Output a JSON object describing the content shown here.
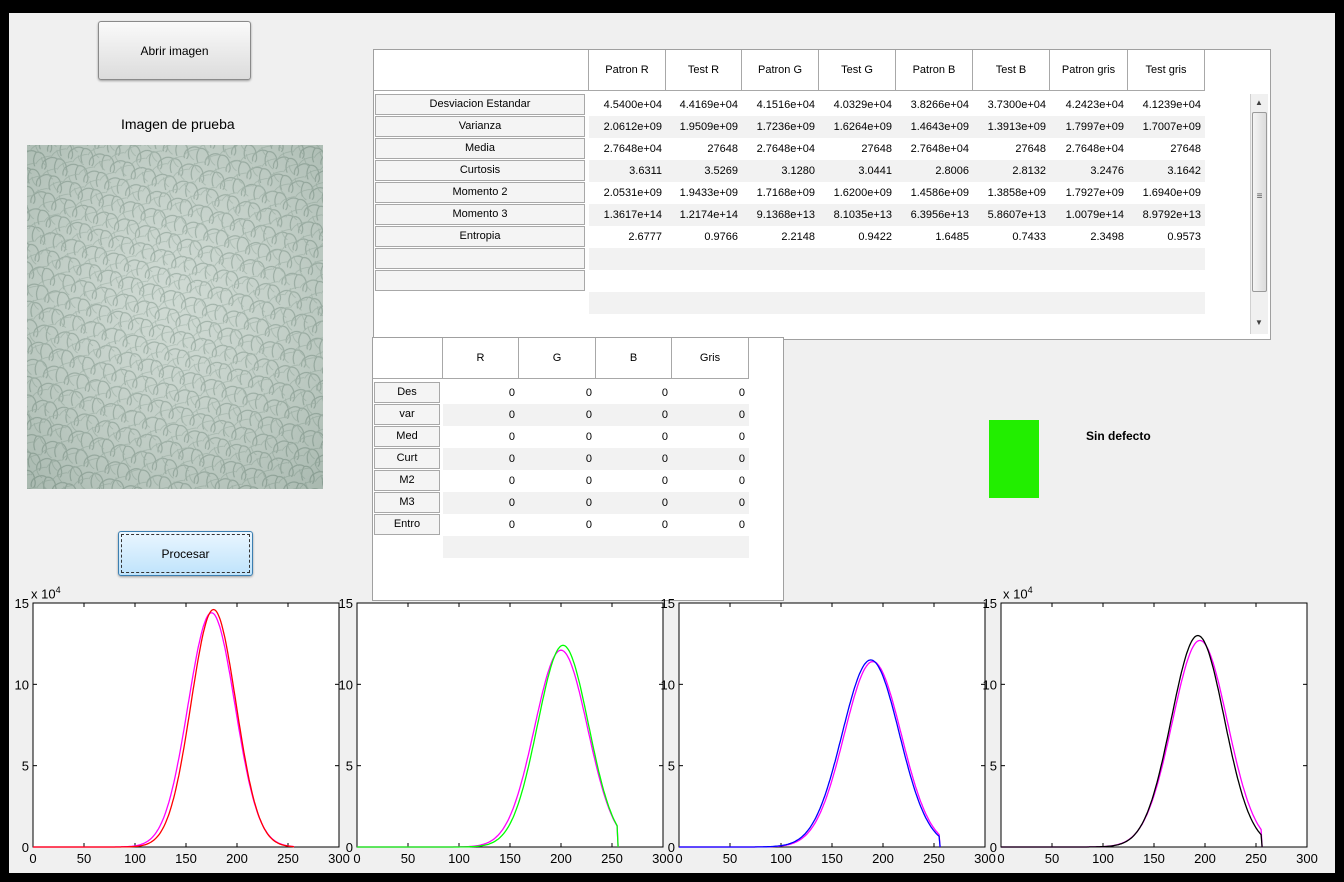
{
  "buttons": {
    "open": "Abrir imagen",
    "process": "Procesar"
  },
  "image_label": "Imagen de prueba",
  "stats_table": {
    "columns": [
      "Patron R",
      "Test R",
      "Patron G",
      "Test G",
      "Patron B",
      "Test B",
      "Patron gris",
      "Test gris"
    ],
    "rows": [
      {
        "label": "Desviacion Estandar",
        "values": [
          "4.5400e+04",
          "4.4169e+04",
          "4.1516e+04",
          "4.0329e+04",
          "3.8266e+04",
          "3.7300e+04",
          "4.2423e+04",
          "4.1239e+04"
        ]
      },
      {
        "label": "Varianza",
        "values": [
          "2.0612e+09",
          "1.9509e+09",
          "1.7236e+09",
          "1.6264e+09",
          "1.4643e+09",
          "1.3913e+09",
          "1.7997e+09",
          "1.7007e+09"
        ]
      },
      {
        "label": "Media",
        "values": [
          "2.7648e+04",
          "27648",
          "2.7648e+04",
          "27648",
          "2.7648e+04",
          "27648",
          "2.7648e+04",
          "27648"
        ]
      },
      {
        "label": "Curtosis",
        "values": [
          "3.6311",
          "3.5269",
          "3.1280",
          "3.0441",
          "2.8006",
          "2.8132",
          "3.2476",
          "3.1642"
        ]
      },
      {
        "label": "Momento 2",
        "values": [
          "2.0531e+09",
          "1.9433e+09",
          "1.7168e+09",
          "1.6200e+09",
          "1.4586e+09",
          "1.3858e+09",
          "1.7927e+09",
          "1.6940e+09"
        ]
      },
      {
        "label": "Momento 3",
        "values": [
          "1.3617e+14",
          "1.2174e+14",
          "9.1368e+13",
          "8.1035e+13",
          "6.3956e+13",
          "5.8607e+13",
          "1.0079e+14",
          "8.9792e+13"
        ]
      },
      {
        "label": "Entropia",
        "values": [
          "2.6777",
          "0.9766",
          "2.2148",
          "0.9422",
          "1.6485",
          "0.7433",
          "2.3498",
          "0.9573"
        ]
      },
      {
        "label": "",
        "values": [
          "",
          "",
          "",
          "",
          "",
          "",
          "",
          ""
        ]
      },
      {
        "label": "",
        "values": [
          "",
          "",
          "",
          "",
          "",
          "",
          "",
          ""
        ]
      }
    ],
    "scroll_grip": "≡"
  },
  "diff_table": {
    "columns": [
      "R",
      "G",
      "B",
      "Gris"
    ],
    "rows": [
      {
        "label": "Des",
        "values": [
          "0",
          "0",
          "0",
          "0"
        ]
      },
      {
        "label": "var",
        "values": [
          "0",
          "0",
          "0",
          "0"
        ]
      },
      {
        "label": "Med",
        "values": [
          "0",
          "0",
          "0",
          "0"
        ]
      },
      {
        "label": "Curt",
        "values": [
          "0",
          "0",
          "0",
          "0"
        ]
      },
      {
        "label": "M2",
        "values": [
          "0",
          "0",
          "0",
          "0"
        ]
      },
      {
        "label": "M3",
        "values": [
          "0",
          "0",
          "0",
          "0"
        ]
      },
      {
        "label": "Entro",
        "values": [
          "0",
          "0",
          "0",
          "0"
        ]
      }
    ]
  },
  "status": {
    "text": "Sin defecto",
    "color": "#22ee00"
  },
  "colors": {
    "red": "#ff0000",
    "magenta": "#ff00ff",
    "green": "#00ff00",
    "blue": "#0000ff",
    "black": "#000000"
  },
  "plot_multiplier": {
    "base": "x 10",
    "exp": "4"
  },
  "chart_data": [
    {
      "type": "line",
      "title": "",
      "xlabel": "",
      "ylabel": "",
      "xlim": [
        0,
        300
      ],
      "ylim": [
        0,
        150000
      ],
      "xticks": [
        "0",
        "50",
        "100",
        "150",
        "200",
        "250",
        "300"
      ],
      "yticks": [
        "0",
        "5",
        "10",
        "15"
      ],
      "series": [
        {
          "color": "magenta",
          "peak_x": 175,
          "peak_y": 144000,
          "sigma": 23,
          "start_x": 40,
          "end_x": 255
        },
        {
          "color": "red",
          "peak_x": 177,
          "peak_y": 146000,
          "sigma": 22,
          "start_x": 40,
          "end_x": 255
        }
      ]
    },
    {
      "type": "line",
      "title": "",
      "xlabel": "",
      "ylabel": "",
      "xlim": [
        0,
        300
      ],
      "ylim": [
        0,
        150000
      ],
      "xticks": [
        "0",
        "50",
        "100",
        "150",
        "200",
        "250",
        "300"
      ],
      "yticks": [
        "0",
        "5",
        "10",
        "15"
      ],
      "series": [
        {
          "color": "magenta",
          "peak_x": 200,
          "peak_y": 121000,
          "sigma": 26,
          "start_x": 40,
          "end_x": 255
        },
        {
          "color": "green",
          "peak_x": 202,
          "peak_y": 124000,
          "sigma": 25,
          "start_x": 40,
          "end_x": 255
        }
      ]
    },
    {
      "type": "line",
      "title": "",
      "xlabel": "",
      "ylabel": "",
      "xlim": [
        0,
        300
      ],
      "ylim": [
        0,
        150000
      ],
      "xticks": [
        "0",
        "50",
        "100",
        "150",
        "200",
        "250",
        "300"
      ],
      "yticks": [
        "0",
        "5",
        "10",
        "15"
      ],
      "series": [
        {
          "color": "magenta",
          "peak_x": 190,
          "peak_y": 114000,
          "sigma": 28,
          "start_x": 5,
          "end_x": 255
        },
        {
          "color": "blue",
          "peak_x": 188,
          "peak_y": 115000,
          "sigma": 28,
          "start_x": 5,
          "end_x": 255
        }
      ]
    },
    {
      "type": "line",
      "title": "",
      "xlabel": "",
      "ylabel": "",
      "xlim": [
        0,
        300
      ],
      "ylim": [
        0,
        150000
      ],
      "xticks": [
        "0",
        "50",
        "100",
        "150",
        "200",
        "250",
        "300"
      ],
      "yticks": [
        "0",
        "5",
        "10",
        "15"
      ],
      "series": [
        {
          "color": "magenta",
          "peak_x": 195,
          "peak_y": 127000,
          "sigma": 27,
          "start_x": 30,
          "end_x": 255
        },
        {
          "color": "black",
          "peak_x": 193,
          "peak_y": 130000,
          "sigma": 26,
          "start_x": 30,
          "end_x": 255
        }
      ]
    }
  ]
}
